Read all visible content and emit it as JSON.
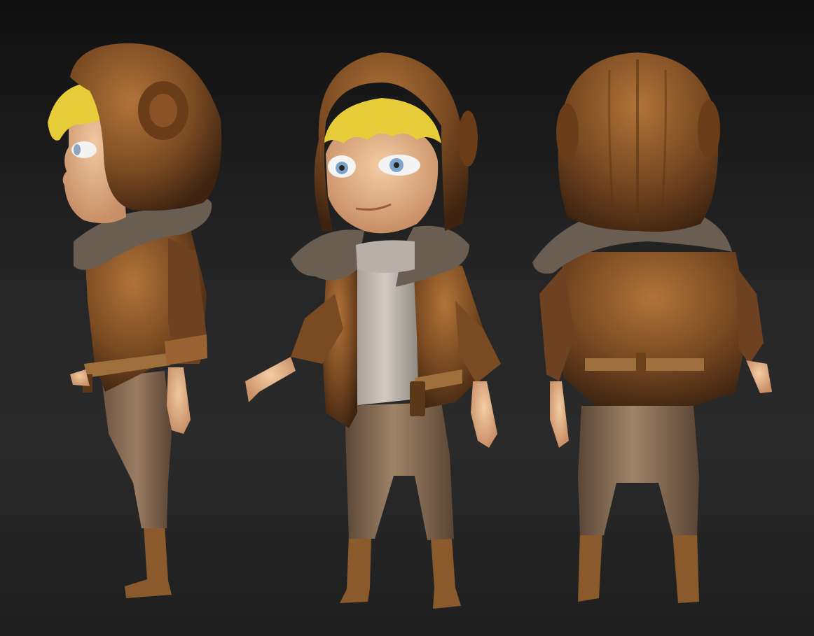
{
  "scene": {
    "description_colors": {
      "leather": "#7a4a22",
      "leather_dark": "#4a2a10",
      "leather_light": "#a06a34",
      "fur": "#6a5e52",
      "skin": "#e2b48a",
      "hair": "#e6cc38",
      "trousers": "#8a6e56",
      "shirt": "#c8c0b6",
      "boots": "#8a5a2c",
      "background": "#222222"
    },
    "views": [
      "side",
      "front",
      "back"
    ]
  }
}
